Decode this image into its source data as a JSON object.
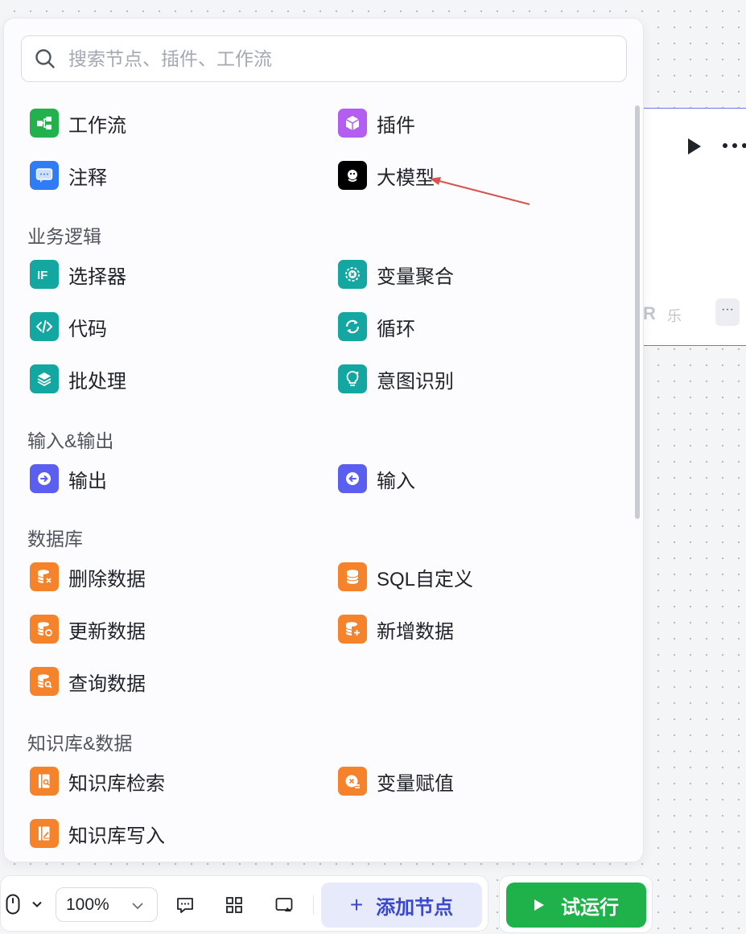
{
  "search": {
    "placeholder": "搜索节点、插件、工作流"
  },
  "top_items": [
    {
      "label": "工作流",
      "icon": "workflow-icon",
      "color": "#22b14c"
    },
    {
      "label": "插件",
      "icon": "plugin-icon",
      "color": "#b35ef0"
    },
    {
      "label": "注释",
      "icon": "comment-icon",
      "color": "#2f7cf6"
    },
    {
      "label": "大模型",
      "icon": "llm-icon",
      "color": "#000000"
    }
  ],
  "sections": [
    {
      "title": "业务逻辑",
      "items": [
        {
          "label": "选择器",
          "icon": "if-icon",
          "color": "#14a6a0"
        },
        {
          "label": "变量聚合",
          "icon": "variable-merge-icon",
          "color": "#14a6a0"
        },
        {
          "label": "代码",
          "icon": "code-icon",
          "color": "#14a6a0"
        },
        {
          "label": "循环",
          "icon": "loop-icon",
          "color": "#14a6a0"
        },
        {
          "label": "批处理",
          "icon": "batch-icon",
          "color": "#14a6a0"
        },
        {
          "label": "意图识别",
          "icon": "intent-icon",
          "color": "#14a6a0"
        }
      ]
    },
    {
      "title": "输入&输出",
      "items": [
        {
          "label": "输出",
          "icon": "output-icon",
          "color": "#5b5ff0"
        },
        {
          "label": "输入",
          "icon": "input-icon",
          "color": "#5b5ff0"
        }
      ]
    },
    {
      "title": "数据库",
      "items": [
        {
          "label": "删除数据",
          "icon": "db-delete-icon",
          "color": "#f5832b"
        },
        {
          "label": "SQL自定义",
          "icon": "db-sql-icon",
          "color": "#f5832b"
        },
        {
          "label": "更新数据",
          "icon": "db-update-icon",
          "color": "#f5832b"
        },
        {
          "label": "新增数据",
          "icon": "db-add-icon",
          "color": "#f5832b"
        },
        {
          "label": "查询数据",
          "icon": "db-query-icon",
          "color": "#f5832b"
        }
      ]
    },
    {
      "title": "知识库&数据",
      "items": [
        {
          "label": "知识库检索",
          "icon": "kb-search-icon",
          "color": "#f5832b"
        },
        {
          "label": "变量赋值",
          "icon": "variable-assign-icon",
          "color": "#f5832b"
        },
        {
          "label": "知识库写入",
          "icon": "kb-write-icon",
          "color": "#f5832b"
        }
      ]
    }
  ],
  "background_node": {
    "initial": "R",
    "caption": "乐",
    "more": "···"
  },
  "toolbar": {
    "zoom": "100%",
    "add_node": "添加节点",
    "add_plus": "+",
    "test_run": "试运行"
  },
  "colors": {
    "accent_blue": "#3a47d1",
    "run_green": "#1fb24a",
    "arrow_red": "#d9534f"
  }
}
